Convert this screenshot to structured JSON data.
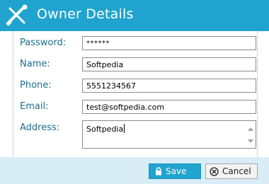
{
  "window": {
    "title": "Owner Details"
  },
  "form": {
    "password": {
      "label": "Password:",
      "value": "******"
    },
    "name": {
      "label": "Name:",
      "value": "Softpedia"
    },
    "phone": {
      "label": "Phone:",
      "value": "5551234567"
    },
    "email": {
      "label": "Email:",
      "value": "test@softpedia.com"
    },
    "address": {
      "label": "Address:",
      "value": "Softpedia"
    }
  },
  "buttons": {
    "save": "Save",
    "cancel": "Cancel"
  },
  "colors": {
    "accent": "#20a4cf",
    "footer": "#d9edf6",
    "label": "#1b6f8e"
  }
}
